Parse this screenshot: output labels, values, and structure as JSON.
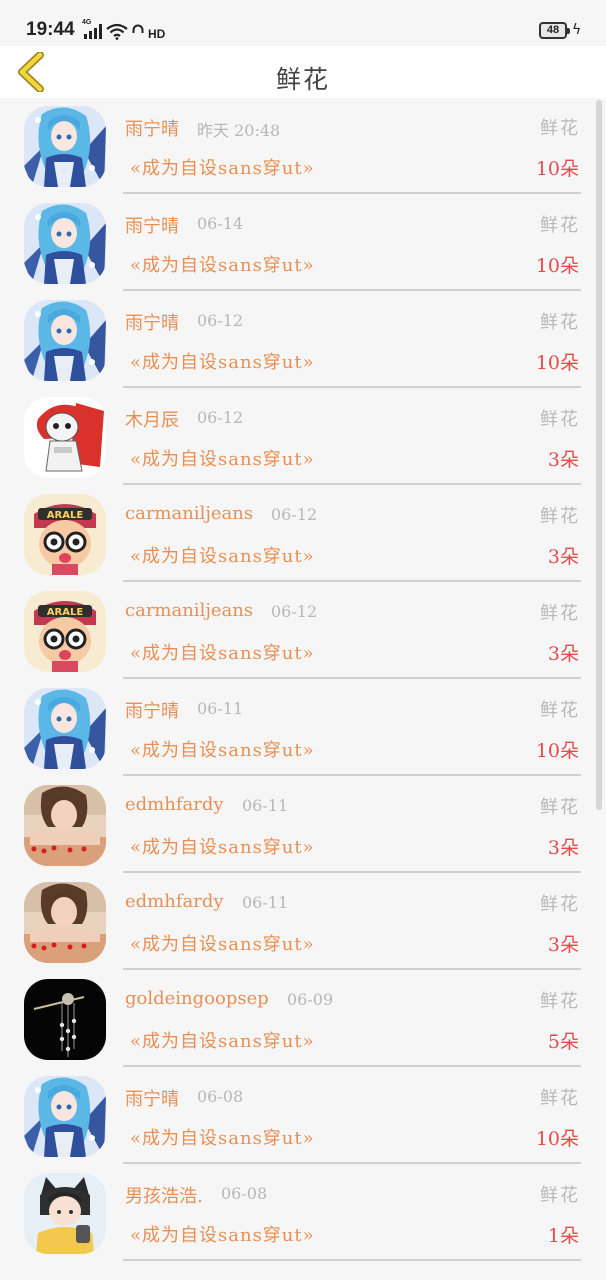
{
  "status": {
    "time": "19:44",
    "network": "4G",
    "hd": "HD",
    "battery": "48"
  },
  "header": {
    "title": "鲜花"
  },
  "colors": {
    "name": "#e98f54",
    "count": "#e34c4c",
    "date": "#b7b7b7"
  },
  "records": [
    {
      "name": "雨宁晴",
      "date": "昨天 20:48",
      "type": "鲜花",
      "title": "«成为自设sans穿ut»",
      "count": "10朵",
      "avatar": "anime-girl-blue-hair"
    },
    {
      "name": "雨宁晴",
      "date": "06-14",
      "type": "鲜花",
      "title": "«成为自设sans穿ut»",
      "count": "10朵",
      "avatar": "anime-girl-blue-hair"
    },
    {
      "name": "雨宁晴",
      "date": "06-12",
      "type": "鲜花",
      "title": "«成为自设sans穿ut»",
      "count": "10朵",
      "avatar": "anime-girl-blue-hair"
    },
    {
      "name": "木月辰",
      "date": "06-12",
      "type": "鲜花",
      "title": "«成为自设sans穿ut»",
      "count": "3朵",
      "avatar": "skeleton-red-hood"
    },
    {
      "name": "carmaniljeans",
      "date": "06-12",
      "type": "鲜花",
      "title": "«成为自设sans穿ut»",
      "count": "3朵",
      "avatar": "arale-cartoon"
    },
    {
      "name": "carmaniljeans",
      "date": "06-12",
      "type": "鲜花",
      "title": "«成为自设sans穿ut»",
      "count": "3朵",
      "avatar": "arale-cartoon"
    },
    {
      "name": "雨宁晴",
      "date": "06-11",
      "type": "鲜花",
      "title": "«成为自设sans穿ut»",
      "count": "10朵",
      "avatar": "anime-girl-blue-hair"
    },
    {
      "name": "edmhfardy",
      "date": "06-11",
      "type": "鲜花",
      "title": "«成为自设sans穿ut»",
      "count": "3朵",
      "avatar": "girl-photo"
    },
    {
      "name": "edmhfardy",
      "date": "06-11",
      "type": "鲜花",
      "title": "«成为自设sans穿ut»",
      "count": "3朵",
      "avatar": "girl-photo"
    },
    {
      "name": "goldeingoopsep",
      "date": "06-09",
      "type": "鲜花",
      "title": "«成为自设sans穿ut»",
      "count": "5朵",
      "avatar": "hairpin-black"
    },
    {
      "name": "雨宁晴",
      "date": "06-08",
      "type": "鲜花",
      "title": "«成为自设sans穿ut»",
      "count": "10朵",
      "avatar": "anime-girl-blue-hair"
    },
    {
      "name": "男孩浩浩.",
      "date": "06-08",
      "type": "鲜花",
      "title": "«成为自设sans穿ut»",
      "count": "1朵",
      "avatar": "boy-cat-ears"
    }
  ]
}
